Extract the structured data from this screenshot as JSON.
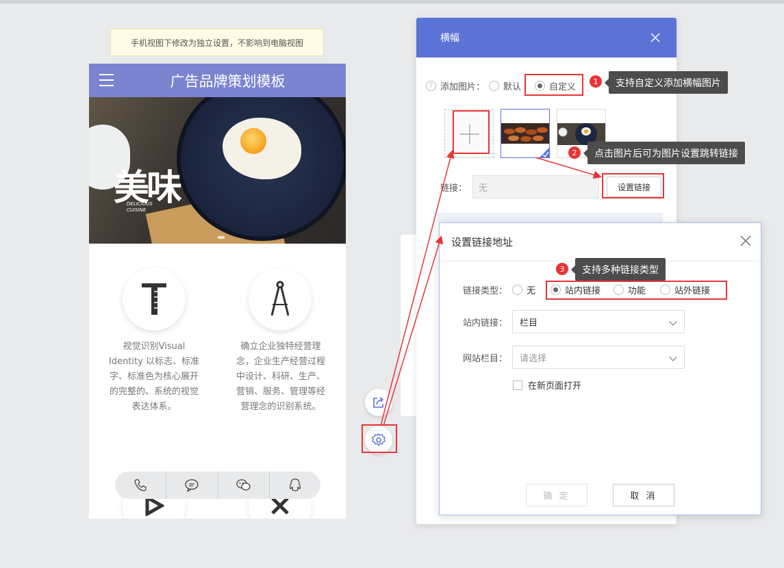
{
  "notice": "手机视图下修改为独立设置，不影响到电脑视图",
  "phone": {
    "title": "广告品牌策划模板",
    "banner": {
      "calligraphy": "美味",
      "subtitle": "DELICIOUS CUISINE"
    },
    "features": [
      {
        "text": "视觉识别Visual Identity 以标志、标准字、标准色为核心展开的完整的、系统的视觉表达体系。"
      },
      {
        "text": "确立企业独特经营理念，企业生产经营过程中设计、科研、生产、营销、服务、管理等经营理念的识别系统。"
      }
    ],
    "contact": [
      "phone-icon",
      "message-icon",
      "wechat-icon",
      "qq-icon"
    ]
  },
  "banner_dialog": {
    "title": "横幅",
    "add_image_label": "添加图片：",
    "help_glyph": "?",
    "option_default": "默认",
    "option_custom": "自定义",
    "link_label": "链接：",
    "link_value": "无",
    "set_link_button": "设置链接"
  },
  "annotations": [
    {
      "num": "1",
      "text": "支持自定义添加横幅图片"
    },
    {
      "num": "2",
      "text": "点击图片后可为图片设置跳转链接"
    },
    {
      "num": "3",
      "text": "支持多种链接类型"
    }
  ],
  "link_dialog": {
    "title": "设置链接地址",
    "link_type_label": "链接类型：",
    "types": [
      "无",
      "站内链接",
      "功能",
      "站外链接"
    ],
    "selected_type": "站内链接",
    "internal_label": "站内链接：",
    "internal_value": "栏目",
    "column_label": "网站栏目：",
    "column_placeholder": "请选择",
    "new_page_label": "在新页面打开",
    "confirm": "确 定",
    "cancel": "取 消"
  },
  "colors": {
    "header": "#7b84cf",
    "dialog_head": "#5b72d6",
    "highlight": "#e53535",
    "tooltip": "#4c4c4c"
  }
}
